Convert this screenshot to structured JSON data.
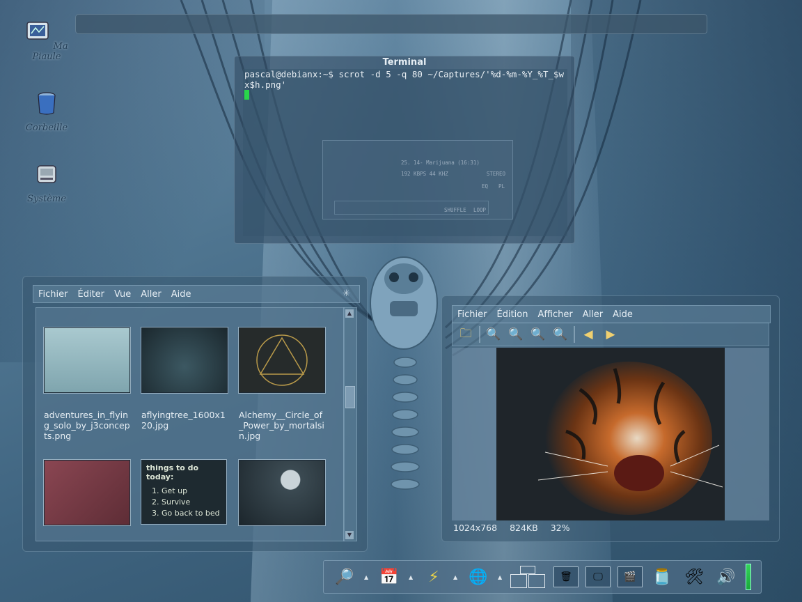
{
  "desktop": {
    "icons": [
      {
        "label": "Ma Piaule",
        "icon": "computer-icon"
      },
      {
        "label": "Corbeille",
        "icon": "trash-icon"
      },
      {
        "label": "Système",
        "icon": "drive-icon"
      }
    ]
  },
  "terminal": {
    "title": "Terminal",
    "command": "pascal@debianx:~$ scrot -d 5 -q 80 ~/Captures/'%d-%m-%Y_%T_$wx$h.png'",
    "player": {
      "track": "25. 14- Marijuana (16:31)",
      "info": "192 KBPS  44 KHZ",
      "stereo": "STEREO",
      "eq": "EQ",
      "pl": "PL",
      "shuffle": "SHUFFLE",
      "loop": "LOOP"
    }
  },
  "file_manager": {
    "menu": [
      "Fichier",
      "Éditer",
      "Vue",
      "Aller",
      "Aide"
    ],
    "files": [
      {
        "name": "adventures_in_flying_solo_by_j3concepts.png",
        "thumb": "#8fb3bd"
      },
      {
        "name": "aflyingtree_1600x120.jpg",
        "thumb": "#25353c"
      },
      {
        "name": "Alchemy__Circle_of_Power_by_mortalsin.jpg",
        "thumb": "#262b2b"
      },
      {
        "name": "",
        "thumb": "#7a3a45"
      },
      {
        "name": "",
        "thumb": "#1e2a30"
      },
      {
        "name": "",
        "thumb": "#3b4a52"
      }
    ],
    "todo": {
      "title": "things to do today:",
      "items": [
        "Get up",
        "Survive",
        "Go back to bed"
      ]
    }
  },
  "image_viewer": {
    "menu": [
      "Fichier",
      "Édition",
      "Afficher",
      "Aller",
      "Aide"
    ],
    "status": {
      "dimensions": "1024x768",
      "size": "824KB",
      "zoom": "32%"
    }
  },
  "dock": {
    "items": [
      "magnifier-icon",
      "calendar-icon",
      "lightning-icon",
      "globe-icon",
      "pager",
      "trash-task-icon",
      "desktop-task-icon",
      "clapper-task-icon",
      "jar-icon",
      "tools-icon",
      "speaker-icon",
      "level-meter"
    ]
  }
}
